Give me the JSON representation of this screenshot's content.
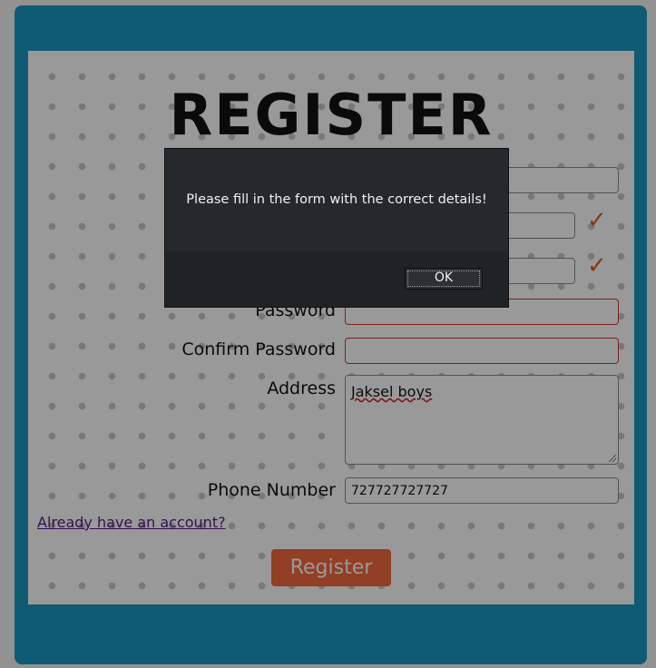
{
  "form": {
    "title": "REGISTER",
    "fields": {
      "password_label": "Password",
      "confirm_password_label": "Confirm Password",
      "address_label": "Address",
      "address_value": "Jaksel boys",
      "phone_label": "Phone Number",
      "phone_value": "727727727727"
    },
    "check_glyph": "✓",
    "login_link": "Already have an account?",
    "register_button": "Register"
  },
  "dialog": {
    "message": "Please fill in the form with the correct details!",
    "ok_label": "OK"
  },
  "colors": {
    "frame": "#1a98c2",
    "accent": "#f26a3f",
    "error_border": "#d23a2a",
    "check": "#e05a2b"
  }
}
